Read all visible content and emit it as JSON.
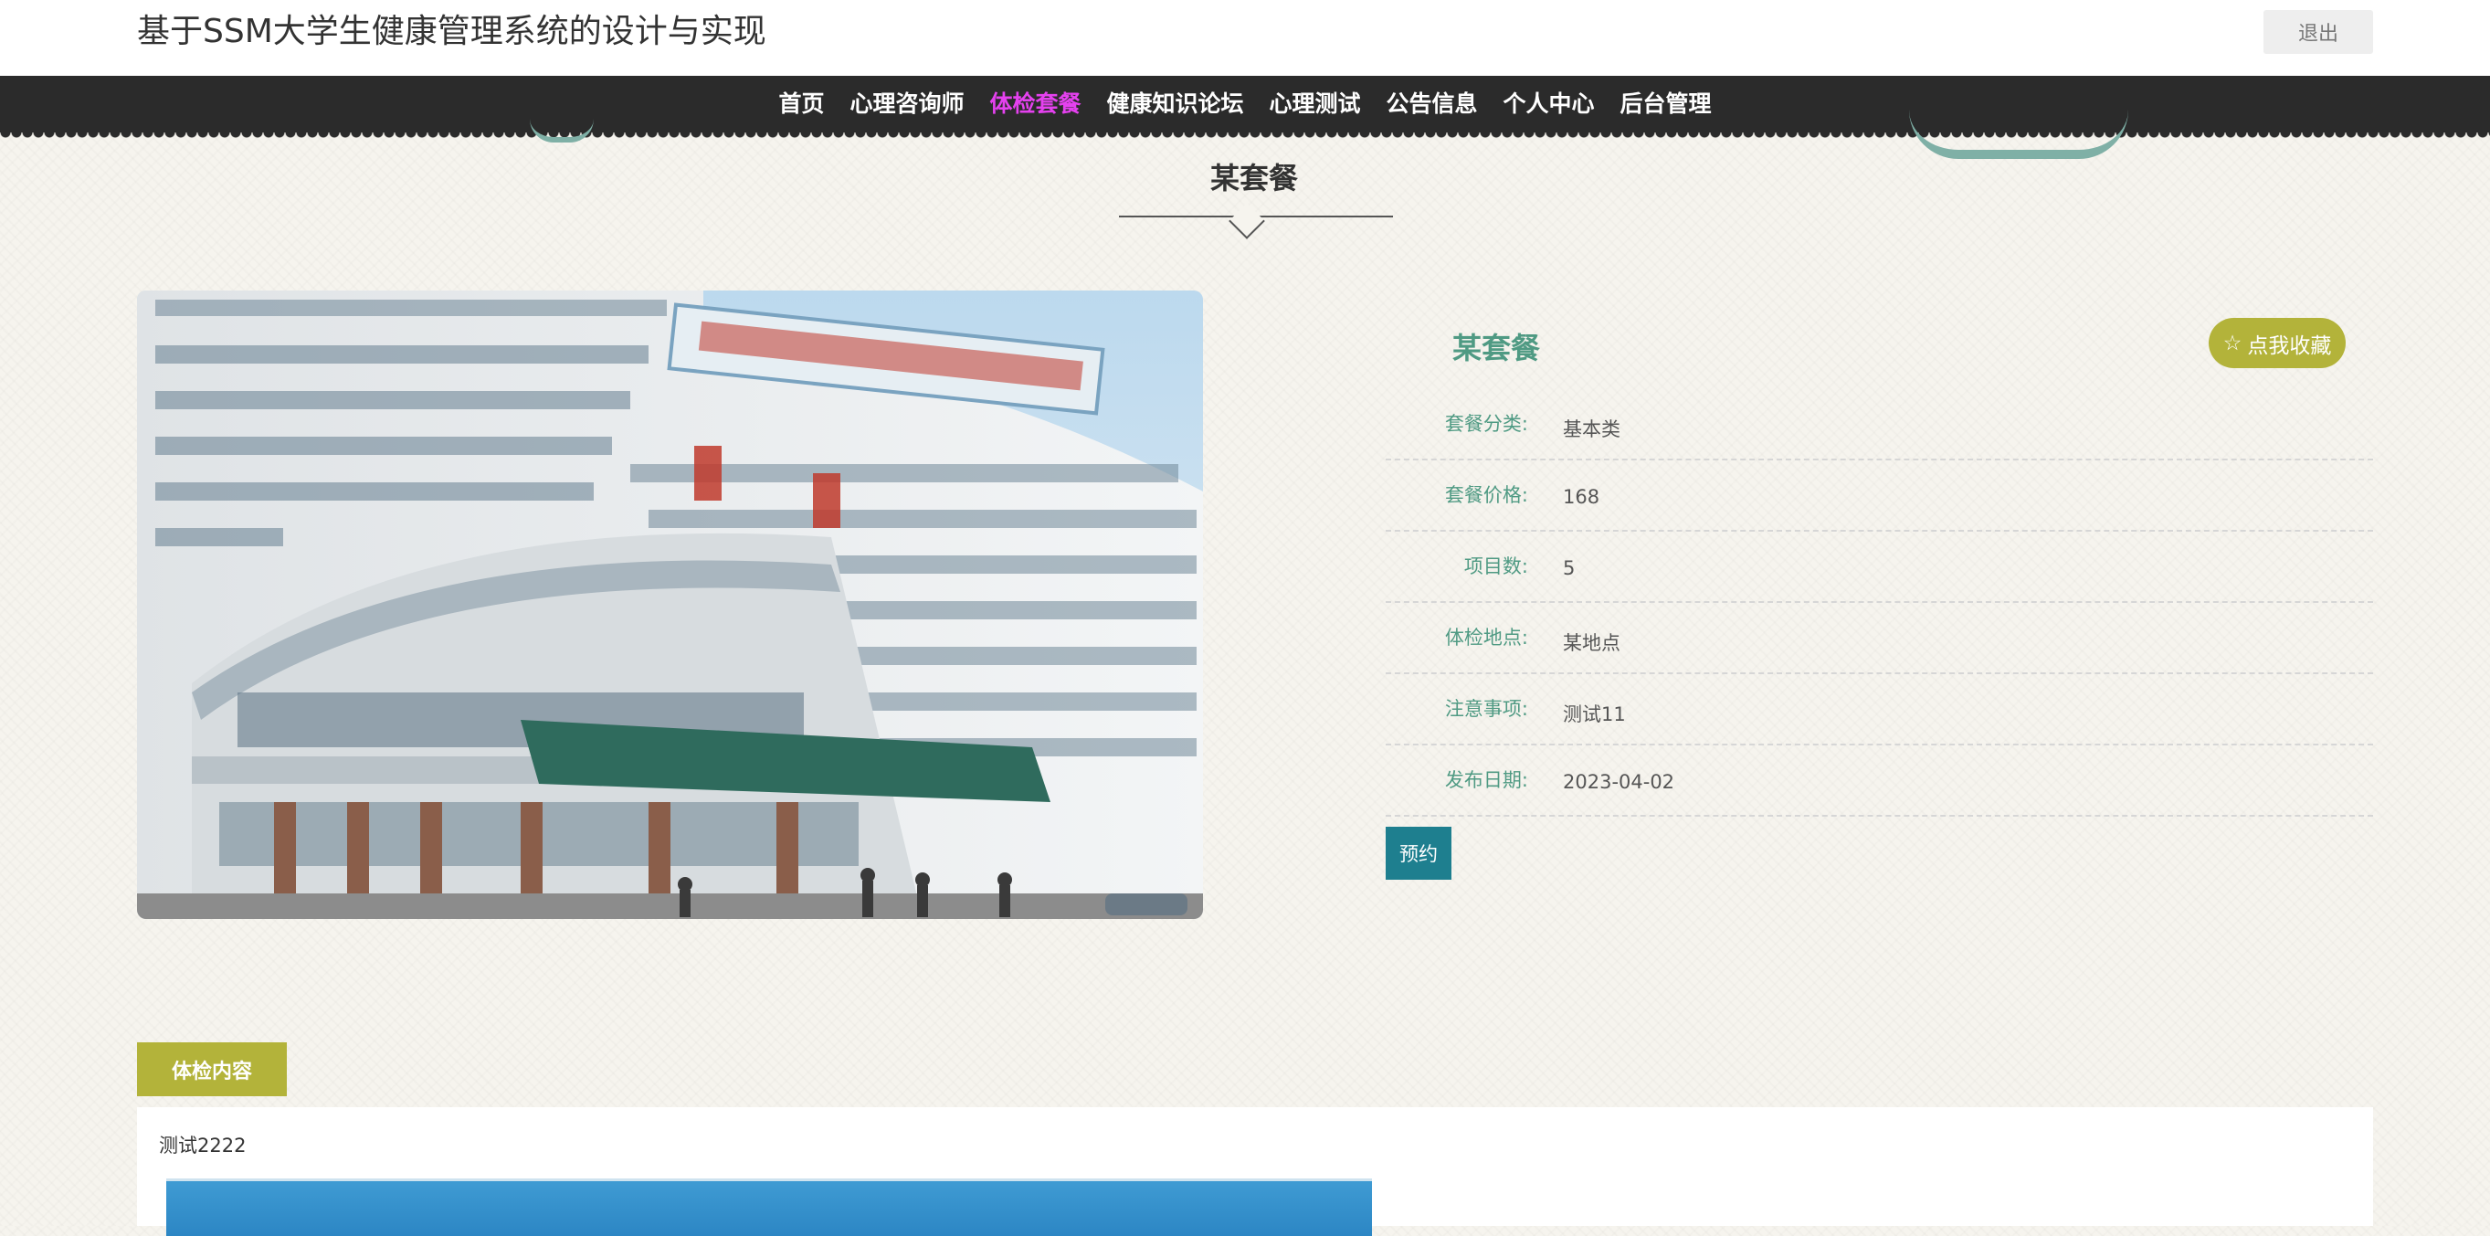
{
  "header": {
    "site_title": "基于SSM大学生健康管理系统的设计与实现",
    "logout_label": "退出"
  },
  "nav": {
    "items": [
      {
        "label": "首页",
        "active": false
      },
      {
        "label": "心理咨询师",
        "active": false
      },
      {
        "label": "体检套餐",
        "active": true
      },
      {
        "label": "健康知识论坛",
        "active": false
      },
      {
        "label": "心理测试",
        "active": false
      },
      {
        "label": "公告信息",
        "active": false
      },
      {
        "label": "个人中心",
        "active": false
      },
      {
        "label": "后台管理",
        "active": false
      }
    ]
  },
  "page": {
    "section_title": "某套餐"
  },
  "detail": {
    "name": "某套餐",
    "favorite_label": "点我收藏",
    "favorite_icon": "star-outline-icon",
    "fields": [
      {
        "label": "套餐分类:",
        "value": "基本类"
      },
      {
        "label": "套餐价格:",
        "value": "168"
      },
      {
        "label": "项目数:",
        "value": "5"
      },
      {
        "label": "体检地点:",
        "value": "某地点"
      },
      {
        "label": "注意事项:",
        "value": "测试11"
      },
      {
        "label": "发布日期:",
        "value": "2023-04-02"
      }
    ],
    "book_label": "预约"
  },
  "tabs": {
    "content_tab_label": "体检内容"
  },
  "content": {
    "text": "测试2222"
  },
  "colors": {
    "nav_bg": "#2b2b2b",
    "nav_active": "#e541ef",
    "accent_green": "#4f9a83",
    "olive": "#b3b33a",
    "teal_button": "#1e7f8f"
  }
}
